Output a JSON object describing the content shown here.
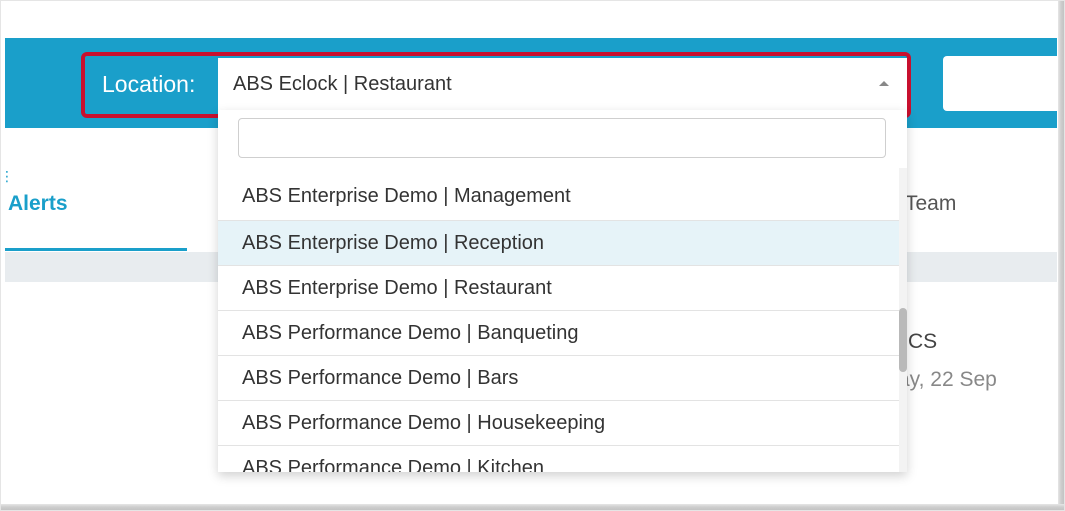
{
  "header": {
    "location_label": "Location:",
    "selected_location": "ABS Eclock | Restaurant"
  },
  "page": {
    "tabs": {
      "alerts": "Alerts",
      "team": "Team"
    },
    "partial_texts": {
      "cs": "CS",
      "date": "ay, 22 Sep"
    }
  },
  "dropdown": {
    "search_value": "",
    "items": [
      "ABS Enterprise Demo | Management",
      "ABS Enterprise Demo | Reception",
      "ABS Enterprise Demo | Restaurant",
      "ABS Performance Demo | Banqueting",
      "ABS Performance Demo | Bars",
      "ABS Performance Demo | Housekeeping",
      "ABS Performance Demo | Kitchen"
    ],
    "hovered_item": "ABS Enterprise Demo | Reception"
  },
  "colors": {
    "header_blue": "#1a9fca",
    "highlight_red": "#c8102e",
    "hover_row": "#e6f3f8"
  }
}
